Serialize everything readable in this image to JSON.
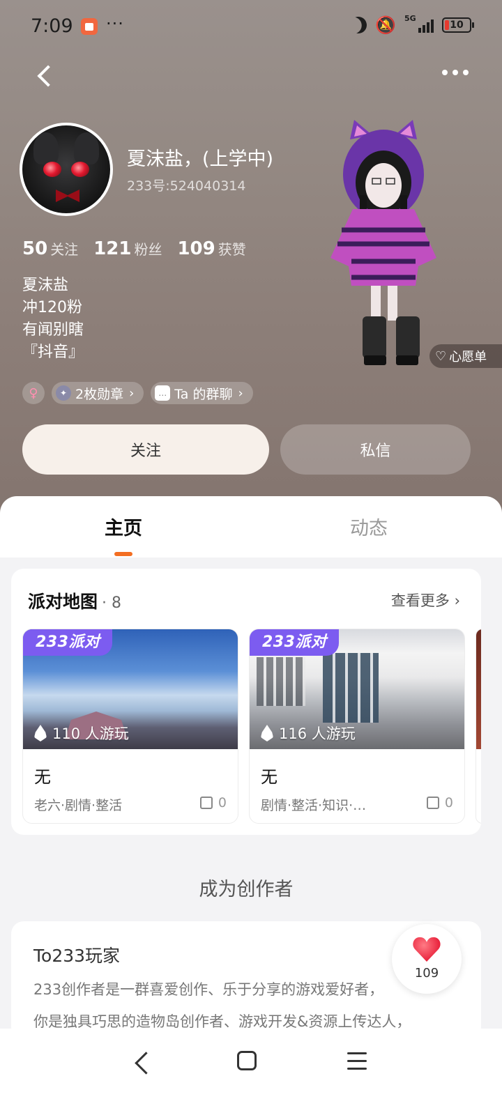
{
  "status_bar": {
    "time": "7:09",
    "more": "···",
    "network_label": "5G",
    "battery": "10",
    "icons": [
      "app-notification-icon",
      "moon-icon",
      "bell-muted-icon",
      "signal-icon",
      "battery-icon"
    ]
  },
  "profile": {
    "nickname": "夏沫盐，(上学中)",
    "uid": "233号:524040314",
    "stats": [
      {
        "value": "50",
        "label": "关注"
      },
      {
        "value": "121",
        "label": "粉丝"
      },
      {
        "value": "109",
        "label": "获赞"
      }
    ],
    "bio": [
      "夏沫盐",
      "冲120粉",
      "有闻别瞎",
      "『抖音』"
    ],
    "gender_icon": "♀",
    "badges_label": "2枚勋章",
    "group_chat_label": "Ta 的群聊",
    "wish_label": "心愿单"
  },
  "actions": {
    "follow": "关注",
    "message": "私信"
  },
  "tabs": {
    "home": "主页",
    "feed": "动态"
  },
  "maps": {
    "title": "派对地图",
    "count": "· 8",
    "see_more": "查看更多",
    "tag": "233派对",
    "games": [
      {
        "players": "110 人游玩",
        "name": "无",
        "tags": "老六·剧情·整活",
        "likes": "0"
      },
      {
        "players": "116 人游玩",
        "name": "无",
        "tags": "剧情·整活·知识·…",
        "likes": "0"
      }
    ]
  },
  "creator": {
    "section_title": "成为创作者",
    "card_title": "To233玩家",
    "line_1": "233创作者是一群喜爱创作、乐于分享的游戏爱好者，",
    "line_2": "你是独具巧思的造物岛创作者、游戏开发&资源上传达人，"
  },
  "like_float": {
    "count": "109"
  },
  "colors": {
    "accent": "#f36e22",
    "tag_purple": "#7c5cf0",
    "heart_red": "#e8203a"
  }
}
